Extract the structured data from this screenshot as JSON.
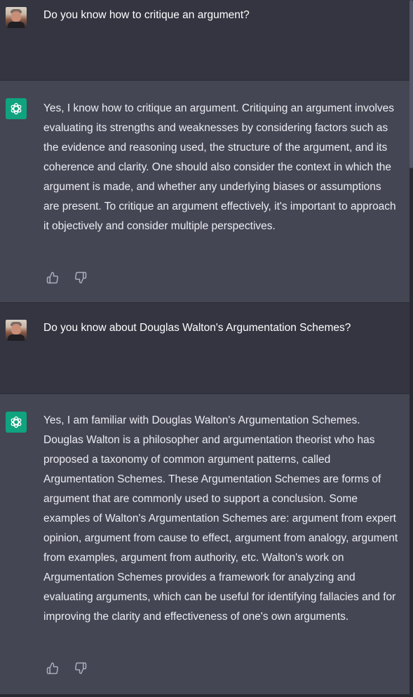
{
  "messages": [
    {
      "role": "user",
      "avatar": "user-avatar",
      "text": "Do you know how to critique an argument?"
    },
    {
      "role": "assistant",
      "avatar": "openai-logo-icon",
      "text": "Yes, I know how to critique an argument. Critiquing an argument involves evaluating its strengths and weaknesses by considering factors such as the evidence and reasoning used, the structure of the argument, and its coherence and clarity. One should also consider the context in which the argument is made, and whether any underlying biases or assumptions are present. To critique an argument effectively, it's important to approach it objectively and consider multiple perspectives.",
      "actions": [
        "thumbs-up-icon",
        "thumbs-down-icon"
      ]
    },
    {
      "role": "user",
      "avatar": "user-avatar",
      "text": "Do you know about Douglas Walton's Argumentation Schemes?"
    },
    {
      "role": "assistant",
      "avatar": "openai-logo-icon",
      "text": "Yes, I am familiar with Douglas Walton's Argumentation Schemes. Douglas Walton is a philosopher and argumentation theorist who has proposed a taxonomy of common argument patterns, called Argumentation Schemes. These Argumentation Schemes are forms of argument that are commonly used to support a conclusion. Some examples of Walton's Argumentation Schemes are: argument from expert opinion, argument from cause to effect, argument from analogy, argument from examples, argument from authority, etc. Walton's work on Argumentation Schemes provides a framework for analyzing and evaluating arguments, which can be useful for identifying fallacies and for improving the clarity and effectiveness of one's own arguments.",
      "actions": [
        "thumbs-up-icon",
        "thumbs-down-icon"
      ]
    }
  ],
  "colors": {
    "background": "#343541",
    "assistant_background": "#444654",
    "brand_green": "#10a37f",
    "text": "#ececf1"
  }
}
